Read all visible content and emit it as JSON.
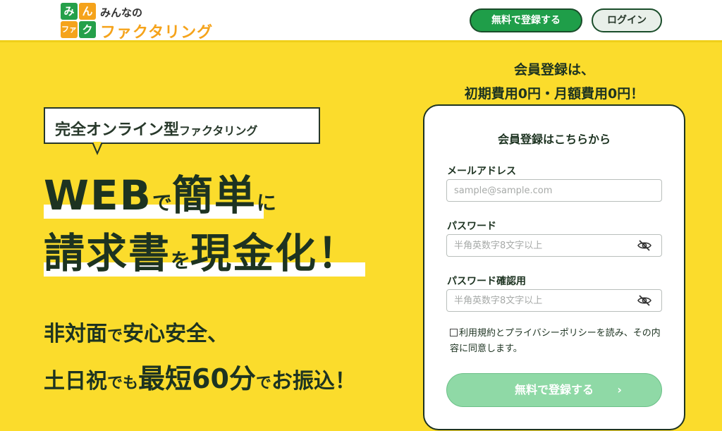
{
  "header": {
    "logo_tiles": [
      "み",
      "ん",
      "ファ",
      "ク"
    ],
    "logo_small": "みんなの",
    "logo_big": "ファクタリング",
    "register_button": "無料で登録する",
    "login_button": "ログイン"
  },
  "hero": {
    "badge_main": "完全オンライン型",
    "badge_sub": "ファクタリング",
    "headline1": {
      "a": "WEB",
      "b": "で",
      "c": "簡単",
      "d": "に"
    },
    "headline2": {
      "a": "請求書",
      "b": "を",
      "c": "現金化！"
    },
    "sub1": {
      "a": "非対面",
      "b": "で",
      "c": "安心安全、"
    },
    "sub2": {
      "a": "土日祝",
      "b": "でも",
      "c": "最短60分",
      "d": "で",
      "e": "お振込！"
    }
  },
  "cta": {
    "line1": "会員登録は、",
    "line2": "初期費用0円・月額費用0円！"
  },
  "form": {
    "title": "会員登録はこちらから",
    "email_label": "メールアドレス",
    "email_placeholder": "sample@sample.com",
    "password_label": "パスワード",
    "password_placeholder": "半角英数字8文字以上",
    "password_confirm_label": "パスワード確認用",
    "password_confirm_placeholder": "半角英数字8文字以上",
    "agree_text": "利用規約とプライバシーポリシーを読み、その内容に同意します。",
    "submit_label": "無料で登録する",
    "submit_arrow": "›"
  },
  "colors": {
    "background": "#fbdc2c",
    "primary_green": "#1f9e49",
    "submit_disabled": "#8fd9a6",
    "accent_orange": "#f5a31b"
  }
}
